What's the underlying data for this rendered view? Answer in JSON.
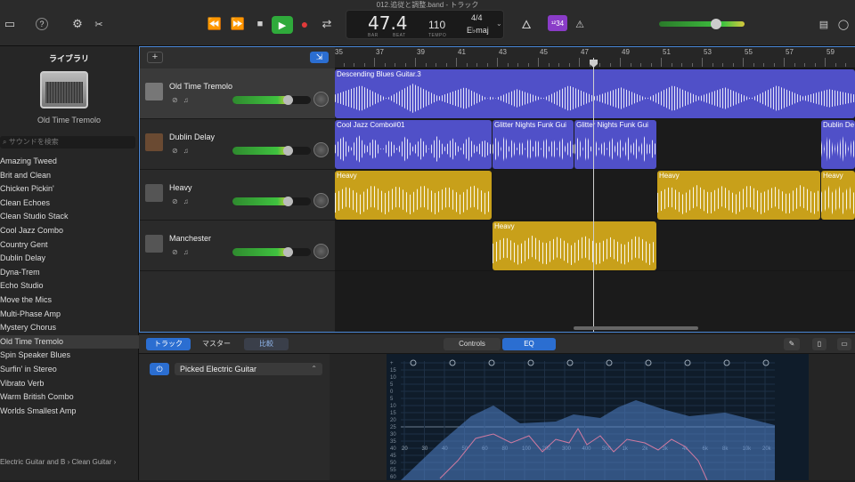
{
  "window": {
    "title": "012.追従と調整.band - トラック"
  },
  "transport": {
    "bar": "47.4",
    "bar_caption": "BAR",
    "beat_caption": "BEAT",
    "tempo": "110",
    "tempo_caption": "TEMPO",
    "time_sig": "4/4",
    "key": "E♭maj",
    "count_in": "¹²34"
  },
  "library": {
    "title": "ライブラリ",
    "selected_name": "Old Time Tremolo",
    "search_placeholder": "サウンドを検索",
    "items": [
      "Amazing Tweed",
      "Brit and Clean",
      "Chicken Pickin'",
      "Clean Echoes",
      "Clean Studio Stack",
      "Cool Jazz Combo",
      "Country Gent",
      "Dublin Delay",
      "Dyna-Trem",
      "Echo Studio",
      "Move the Mics",
      "Multi-Phase Amp",
      "Mystery Chorus",
      "Old Time Tremolo",
      "Spin Speaker Blues",
      "Surfin' in Stereo",
      "Vibrato Verb",
      "Warm British Combo",
      "Worlds Smallest Amp"
    ],
    "selected_index": 13,
    "footer_path": "Electric Guitar and B ›  Clean Guitar ›"
  },
  "tracks": [
    {
      "name": "Old Time Tremolo",
      "volume": 0.72,
      "selected": true
    },
    {
      "name": "Dublin Delay",
      "volume": 0.72,
      "selected": false
    },
    {
      "name": "Heavy",
      "volume": 0.72,
      "selected": false
    },
    {
      "name": "Manchester",
      "volume": 0.72,
      "selected": false
    }
  ],
  "ruler": {
    "labels": [
      "35",
      "37",
      "39",
      "41",
      "43",
      "45",
      "47",
      "49",
      "51",
      "53",
      "55",
      "57",
      "59"
    ]
  },
  "regions": {
    "track1": [
      {
        "name": "Descending Blues Guitar.3"
      }
    ],
    "track2": [
      {
        "name": "Cool Jazz Combo#01"
      },
      {
        "name": "Glitter Nights Funk Gui"
      },
      {
        "name": "Glitter Nights Funk Gui"
      },
      {
        "name": "Dublin De"
      }
    ],
    "track3": [
      {
        "name": "Heavy"
      },
      {
        "name": "Heavy"
      },
      {
        "name": "Heavy"
      }
    ],
    "track4": [
      {
        "name": "Heavy"
      }
    ]
  },
  "smart_controls": {
    "tabs_left": [
      "トラック",
      "マスター",
      "比較"
    ],
    "tabs_center": [
      "Controls",
      "EQ"
    ],
    "preset": "Picked Electric Guitar",
    "eq_freq_labels": [
      "20",
      "30",
      "40",
      "50",
      "60",
      "80",
      "100",
      "200",
      "300",
      "400",
      "500",
      "1k",
      "2k",
      "3k",
      "4k",
      "6k",
      "8k",
      "10k",
      "20k"
    ],
    "eq_db_labels": [
      "+",
      "15",
      "10",
      "5",
      "0",
      "5",
      "10",
      "15",
      "20",
      "25",
      "30",
      "35",
      "40",
      "45",
      "50",
      "55",
      "60"
    ]
  },
  "colors": {
    "accent": "#2b6ed1",
    "region_audio": "#5050c8",
    "region_drummer": "#c8a01a",
    "play": "#2faa3b"
  }
}
